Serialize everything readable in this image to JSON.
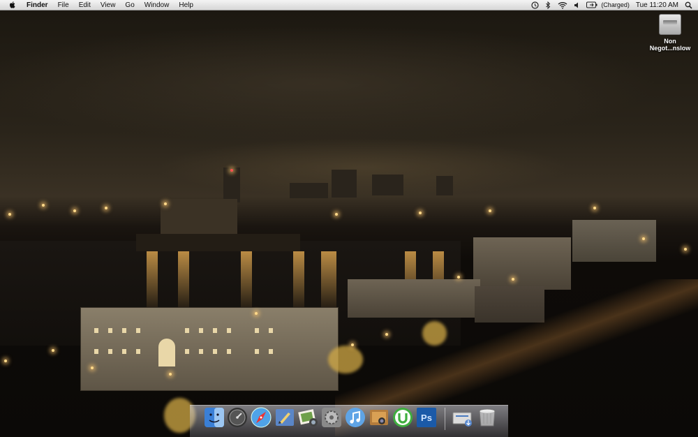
{
  "menubar": {
    "app_name": "Finder",
    "menus": [
      "File",
      "Edit",
      "View",
      "Go",
      "Window",
      "Help"
    ],
    "battery_status": "(Charged)",
    "clock": "Tue 11:20 AM",
    "status_icons": [
      "time-machine-icon",
      "bluetooth-icon",
      "wifi-icon",
      "volume-icon",
      "battery-icon",
      "spotlight-icon"
    ]
  },
  "desktop": {
    "drive_icon": {
      "label_line1": "Non",
      "label_line2": "Negot...nslow"
    }
  },
  "dock": {
    "items": [
      {
        "name": "finder-icon",
        "color": "#3a7fd6"
      },
      {
        "name": "dashboard-icon",
        "color": "#333333"
      },
      {
        "name": "safari-icon",
        "color": "#4fa3e8"
      },
      {
        "name": "mail-icon",
        "color": "#5a86c8"
      },
      {
        "name": "iphoto-icon",
        "color": "#c9a86b"
      },
      {
        "name": "system-preferences-icon",
        "color": "#8a8a8a"
      },
      {
        "name": "itunes-icon",
        "color": "#5fa4e6"
      },
      {
        "name": "photo-booth-icon",
        "color": "#b47c3c"
      },
      {
        "name": "utorrent-icon",
        "color": "#3fae3f"
      },
      {
        "name": "photoshop-icon",
        "color": "#1b5aa8"
      },
      {
        "name": "downloads-stack-icon",
        "color": "#dcdcdc"
      },
      {
        "name": "trash-icon",
        "color": "#cfcfcf"
      }
    ],
    "photoshop_label": "Ps"
  }
}
